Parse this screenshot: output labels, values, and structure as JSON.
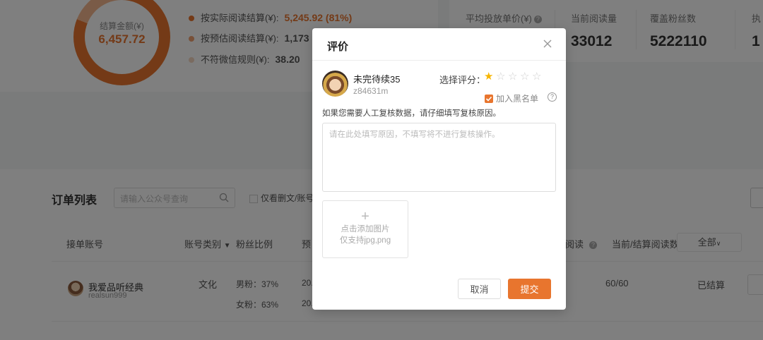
{
  "summary": {
    "donut_label": "结算金额(¥)",
    "donut_value": "6,457.72",
    "donut_actual_share": 0.81,
    "legend": [
      {
        "label": "按实际阅读结算(¥):",
        "value": "5,245.92 (81%)",
        "color": "#e8752e",
        "value_color": "#e8752e"
      },
      {
        "label": "按预估阅读结算(¥):",
        "value": "1,173",
        "color": "#f0a070",
        "value_color": "#333333"
      },
      {
        "label": "不符微信规则(¥):",
        "value": "38.20",
        "color": "#f5d6c0",
        "value_color": "#333333"
      }
    ]
  },
  "stats": {
    "avg_price_label": "平均投放单价(¥)",
    "current_reads_label": "当前阅读量",
    "current_reads_value": "33012",
    "fans_label": "覆盖粉丝数",
    "fans_value": "5222110",
    "exec_label": "执",
    "exec_value": "1"
  },
  "orders": {
    "title": "订单列表",
    "search_placeholder": "请输入公众号查询",
    "only_checkbox_label": "仅看删文/账号",
    "columns": {
      "account": "接单账号",
      "account_type": "账号类别",
      "fans_ratio": "粉丝比例",
      "pre": "预",
      "reads": "阅读",
      "current_settle": "当前/结算阅读数"
    },
    "filter_all": "全部",
    "rows": [
      {
        "name": "我爱品听经典",
        "id": "realsun999",
        "category": "文化",
        "male": "男粉：37%",
        "female": "女粉：63%",
        "date_a": "20.",
        "date_b": "20.",
        "reads": "60/60",
        "status": "已结算"
      }
    ]
  },
  "modal": {
    "title": "评价",
    "user_name": "未完待续35",
    "user_id": "z84631m",
    "rating_label": "选择评分：",
    "rating": 1,
    "rating_max": 5,
    "blacklist_label": "加入黑名单",
    "blacklist_checked": true,
    "hint": "如果您需要人工复核数据，请仔细填写复核原因。",
    "reason_placeholder": "请在此处填写原因，不填写将不进行复核操作。",
    "upload_line1": "点击添加图片",
    "upload_line2": "仅支持jpg,png",
    "cancel_label": "取消",
    "submit_label": "提交",
    "accent_color": "#e8752e"
  }
}
